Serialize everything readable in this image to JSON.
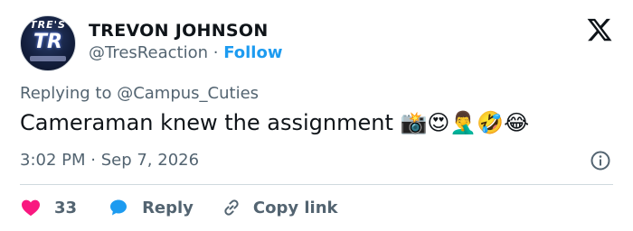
{
  "author": {
    "name": "TREVON JOHNSON",
    "handle": "@TresReaction",
    "separator": "·",
    "follow_label": "Follow",
    "avatar_text": "TRE'S",
    "avatar_logo": "TR"
  },
  "tweet": {
    "replying_to": "Replying to @Campus_Cuties",
    "text": "Cameraman knew the assignment 📸😍🤦‍♂️🤣😂",
    "timestamp": "3:02 PM · Sep 7, 2026"
  },
  "actions": {
    "likes": "33",
    "reply_label": "Reply",
    "copy_link_label": "Copy link"
  },
  "colors": {
    "accent": "#1d9bf0",
    "like": "#f91880",
    "text_secondary": "#536471",
    "text_primary": "#0f1419"
  },
  "icons": [
    "x-logo-icon",
    "info-icon",
    "heart-icon",
    "reply-bubble-icon",
    "link-icon"
  ]
}
